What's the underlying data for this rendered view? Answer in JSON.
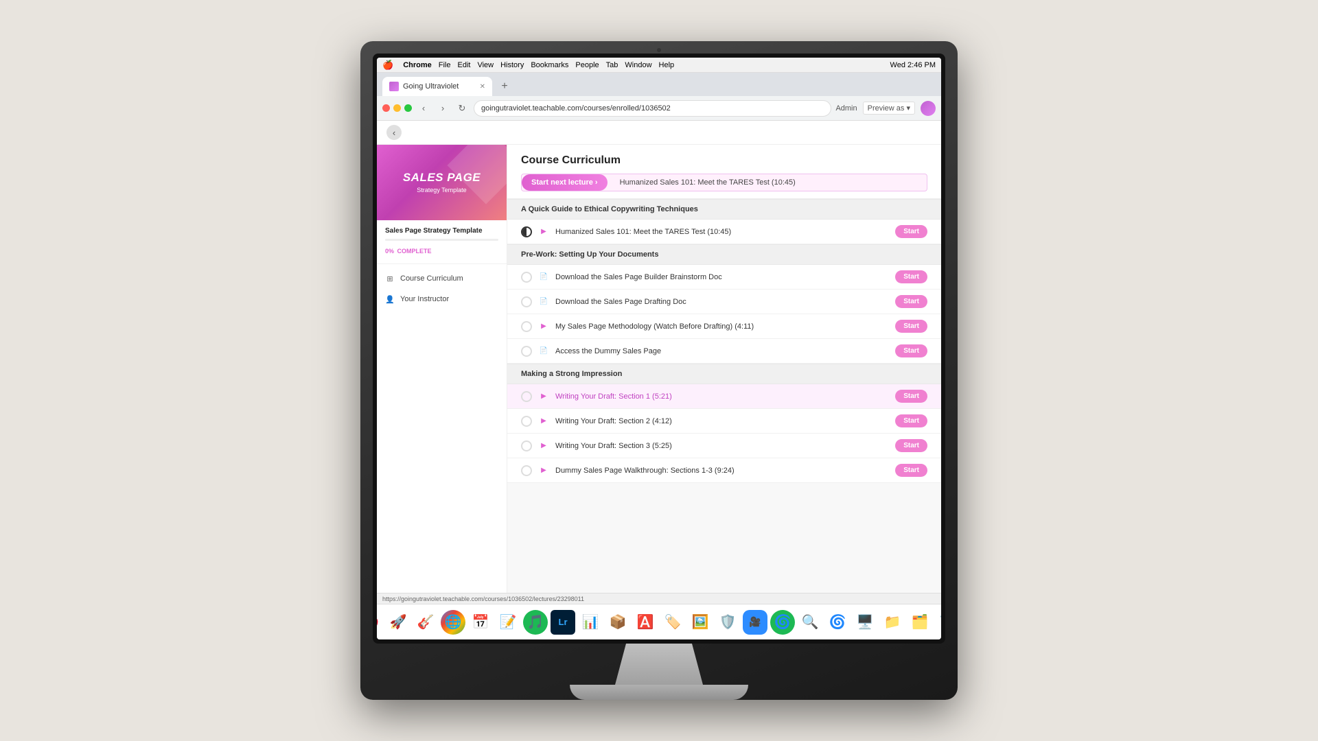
{
  "monitor": {
    "webcam_label": "webcam"
  },
  "menubar": {
    "apple": "🍎",
    "items": [
      "Chrome",
      "File",
      "Edit",
      "View",
      "History",
      "Bookmarks",
      "People",
      "Tab",
      "Window",
      "Help"
    ],
    "right": [
      "Wed 2:46 PM"
    ]
  },
  "tab": {
    "label": "Going Ultraviolet",
    "close": "✕",
    "new": "+"
  },
  "address_bar": {
    "url": "goingutraviolet.teachable.com/courses/enrolled/1036502",
    "star": "☆"
  },
  "chrome_header_right": {
    "admin_label": "Admin",
    "preview_label": "Preview as ▾"
  },
  "sidebar": {
    "course_image_title_big": "SALES PAGE",
    "course_image_title_sub": "Strategy Template",
    "course_name": "Sales Page Strategy Template",
    "progress_pct": "0%",
    "progress_label": "COMPLETE",
    "nav_items": [
      {
        "icon": "grid",
        "label": "Course Curriculum"
      },
      {
        "icon": "user",
        "label": "Your Instructor"
      }
    ]
  },
  "curriculum": {
    "title": "Course Curriculum",
    "start_next_label": "Start next lecture ›",
    "start_next_lecture": "Humanized Sales 101: Meet the TARES Test (10:45)",
    "sections": [
      {
        "header": "A Quick Guide to Ethical Copywriting Techniques",
        "lessons": [
          {
            "check": "half",
            "type": "video",
            "title": "Humanized Sales 101: Meet the TARES Test (10:45)",
            "btn": "Start",
            "highlighted": false
          }
        ]
      },
      {
        "header": "Pre-Work: Setting Up Your Documents",
        "lessons": [
          {
            "check": "empty",
            "type": "doc",
            "title": "Download the Sales Page Builder Brainstorm Doc",
            "btn": "Start",
            "highlighted": false
          },
          {
            "check": "empty",
            "type": "doc",
            "title": "Download the Sales Page Drafting Doc",
            "btn": "Start",
            "highlighted": false
          },
          {
            "check": "empty",
            "type": "video",
            "title": "My Sales Page Methodology (Watch Before Drafting) (4:11)",
            "btn": "Start",
            "highlighted": false
          },
          {
            "check": "empty",
            "type": "doc",
            "title": "Access the Dummy Sales Page",
            "btn": "Start",
            "highlighted": false
          }
        ]
      },
      {
        "header": "Making a Strong Impression",
        "lessons": [
          {
            "check": "empty",
            "type": "video",
            "title": "Writing Your Draft: Section 1 (5:21)",
            "btn": "Start",
            "highlighted": true
          },
          {
            "check": "empty",
            "type": "video",
            "title": "Writing Your Draft: Section 2 (4:12)",
            "btn": "Start",
            "highlighted": false
          },
          {
            "check": "empty",
            "type": "video",
            "title": "Writing Your Draft: Section 3 (5:25)",
            "btn": "Start",
            "highlighted": false
          },
          {
            "check": "empty",
            "type": "video",
            "title": "Dummy Sales Page Walkthrough: Sections 1-3 (9:24)",
            "btn": "Start",
            "highlighted": false
          }
        ]
      }
    ]
  },
  "status_bar": {
    "url": "https://goingutraviolet.teachable.com/courses/1036502/lectures/23298011"
  },
  "dock": {
    "icons": [
      "🍎",
      "🚀",
      "🎸",
      "🌐",
      "📅",
      "📝",
      "🌿",
      "📷",
      "📊",
      "📦",
      "🎮",
      "🎵",
      "🔍",
      "🌀",
      "📱",
      "🖥️",
      "🗂️",
      "🗑️"
    ]
  }
}
